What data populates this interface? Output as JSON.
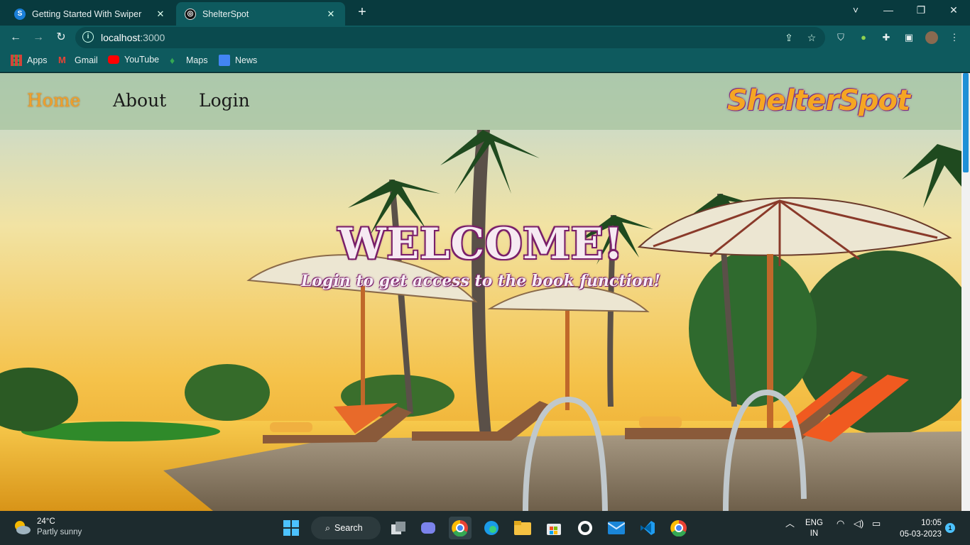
{
  "browser": {
    "tabs": [
      {
        "title": "Getting Started With Swiper",
        "active": false
      },
      {
        "title": "ShelterSpot",
        "active": true
      }
    ],
    "new_tab_label": "+",
    "url_host": "localhost",
    "url_port": ":3000",
    "bookmarks": [
      "Apps",
      "Gmail",
      "YouTube",
      "Maps",
      "News"
    ],
    "window_controls": [
      "˅",
      "—",
      "❐",
      "✕"
    ]
  },
  "site": {
    "nav": {
      "home": "Home",
      "about": "About",
      "login": "Login"
    },
    "brand": "ShelterSpot",
    "hero": {
      "title": "WELCOME!",
      "subtitle": "Login to get access to the book function!"
    }
  },
  "taskbar": {
    "weather_temp": "24°C",
    "weather_desc": "Partly sunny",
    "search_label": "Search",
    "lang_top": "ENG",
    "lang_bottom": "IN",
    "time": "10:05",
    "date": "05-03-2023",
    "notification_count": "1"
  },
  "colors": {
    "chrome_bg": "#0e5a5e",
    "nav_active": "#f0a02a",
    "brand": "#f5a623",
    "heading_outline": "#7a1f6a"
  }
}
